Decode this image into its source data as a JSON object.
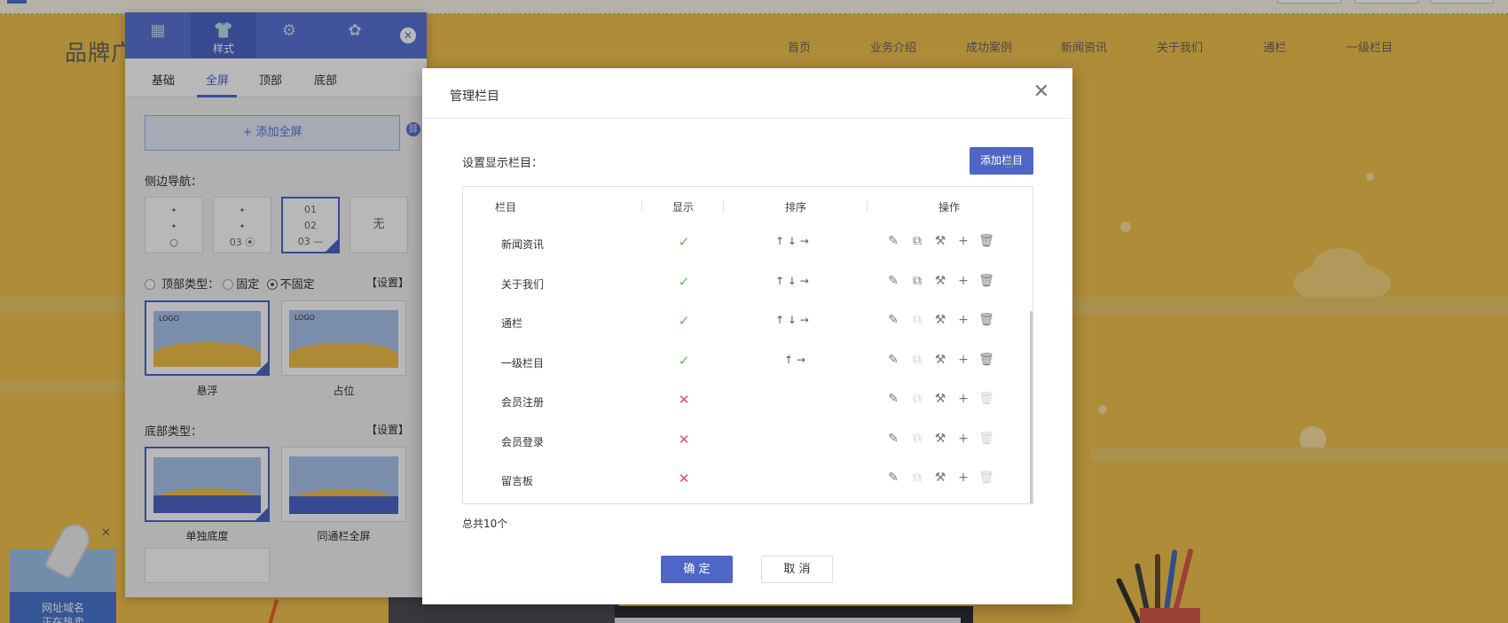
{
  "site": {
    "brand": "品牌广",
    "nav": [
      "首页",
      "业务介绍",
      "成功案例",
      "新闻资讯",
      "关于我们",
      "通栏",
      "一级栏目"
    ],
    "promo_text": "网址域名\n正在热卖"
  },
  "panel": {
    "tabs": [
      {
        "icon": "grid-icon",
        "label": ""
      },
      {
        "icon": "shirt-icon",
        "label": "样式"
      },
      {
        "icon": "gear-icon",
        "label": ""
      },
      {
        "icon": "paw-icon",
        "label": ""
      }
    ],
    "subtabs": [
      "基础",
      "全屏",
      "顶部",
      "底部"
    ],
    "active_subtab": "全屏",
    "add_fullscreen": "+ 添加全屏",
    "side_nav_label": "侧边导航：",
    "side_nav_options": [
      {
        "text": "•\n•\n○"
      },
      {
        "text": "•\n•\n03 ⦿"
      },
      {
        "text": "01\n02\n03 —"
      },
      {
        "text": "无"
      }
    ],
    "top_type_label": "顶部类型：",
    "top_type_fixed": "固定",
    "top_type_unfixed": "不固定",
    "top_set": "【设置】",
    "top_thumbs": [
      "悬浮",
      "占位"
    ],
    "bottom_type_label": "底部类型：",
    "bottom_set": "【设置】",
    "bottom_thumbs": [
      "单独底度",
      "同通栏全屏"
    ],
    "thumb_logo": "LOGO"
  },
  "modal": {
    "title": "管理栏目",
    "set_label": "设置显示栏目：",
    "add_button": "添加栏目",
    "columns": [
      "栏目",
      "显示",
      "排序",
      "操作"
    ],
    "rows": [
      {
        "name": "新闻资讯",
        "show": true,
        "sort": "↑ ↓ →"
      },
      {
        "name": "关于我们",
        "show": true,
        "sort": "↑ ↓ →"
      },
      {
        "name": "通栏",
        "show": true,
        "sort": "↑ ↓ →"
      },
      {
        "name": "一级栏目",
        "show": true,
        "sort": "↑ →"
      },
      {
        "name": "会员注册",
        "show": false,
        "sort": ""
      },
      {
        "name": "会员登录",
        "show": false,
        "sort": ""
      },
      {
        "name": "留言板",
        "show": false,
        "sort": ""
      }
    ],
    "total": "总共10个",
    "ok": "确 定",
    "cancel": "取 消",
    "check_glyph": "✓",
    "cross_glyph": "✕"
  },
  "colors": {
    "accent": "#4d66c8",
    "site_bg": "#f2c24e",
    "show_yes": "#5fb155",
    "show_no": "#e0496b"
  }
}
